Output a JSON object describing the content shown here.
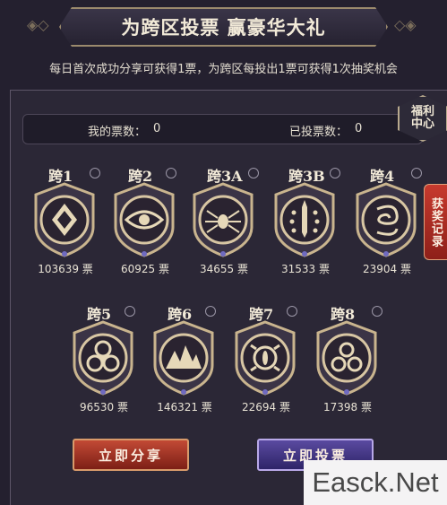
{
  "header": {
    "title": "为跨区投票 赢豪华大礼",
    "subtitle": "每日首次成功分享可获得1票，为跨区每投出1票可获得1次抽奖机会"
  },
  "counters": {
    "my_votes_label": "我的票数：",
    "my_votes_value": "0",
    "cast_votes_label": "已投票数：",
    "cast_votes_value": "0"
  },
  "welfare_center": {
    "line1": "福利",
    "line2": "中心"
  },
  "record_tab": "获奖记录",
  "servers": [
    {
      "name": "跨1",
      "votes": "103639 票",
      "icon": "diamond-rune-icon"
    },
    {
      "name": "跨2",
      "votes": "60925 票",
      "icon": "eye-icon"
    },
    {
      "name": "跨3A",
      "votes": "34655 票",
      "icon": "spider-icon"
    },
    {
      "name": "跨3B",
      "votes": "31533 票",
      "icon": "sword-icon"
    },
    {
      "name": "跨4",
      "votes": "23904 票",
      "icon": "spiral-rune-icon"
    },
    {
      "name": "跨5",
      "votes": "96530 票",
      "icon": "biohazard-icon"
    },
    {
      "name": "跨6",
      "votes": "146321 票",
      "icon": "mountain-icon"
    },
    {
      "name": "跨7",
      "votes": "22694 票",
      "icon": "demon-eye-icon"
    },
    {
      "name": "跨8",
      "votes": "17398 票",
      "icon": "triple-circle-icon"
    }
  ],
  "buttons": {
    "share_label": "立即分享",
    "vote_label": "立即投票"
  },
  "watermark": "Easck.Net",
  "colors": {
    "background": "#24202f",
    "share_button": "#c24a35",
    "vote_button": "#5a4aa0",
    "medal_gold": "#c9b48e"
  }
}
